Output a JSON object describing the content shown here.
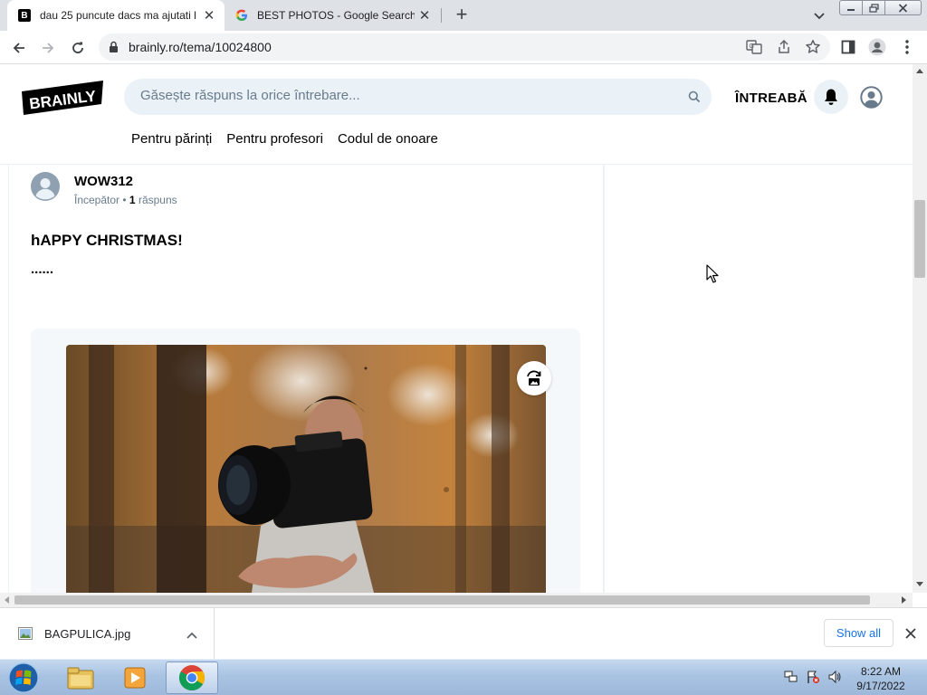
{
  "browser": {
    "tabs": [
      {
        "title": "dau 25 puncute dacs ma ajutati l",
        "favicon": "brainly-favicon-icon",
        "active": true
      },
      {
        "title": "BEST PHOTOS - Google Search",
        "favicon": "google-favicon-icon",
        "active": false
      }
    ],
    "url": "brainly.ro/tema/10024800"
  },
  "page": {
    "logo_text": "BRAINLY",
    "search_placeholder": "Găsește răspuns la orice întrebare...",
    "ask_label": "ÎNTREABĂ",
    "subnav": [
      "Pentru părinți",
      "Pentru profesori",
      "Codul de onoare"
    ],
    "author": {
      "name": "WOW312",
      "rank": "Începător",
      "separator": " • ",
      "answers_count": "1",
      "answers_label": " răspuns"
    },
    "question_title": "hAPPY CHRISTMAS!",
    "question_body": "......"
  },
  "downloads": {
    "file_name": "BAGPULICA.jpg",
    "show_all_label": "Show all"
  },
  "taskbar": {
    "time": "8:22 AM",
    "date": "9/17/2022"
  },
  "colors": {
    "search_bg": "#ebf2f7",
    "accent_link": "#1a73e8",
    "tabstrip": "#dee1e6"
  }
}
